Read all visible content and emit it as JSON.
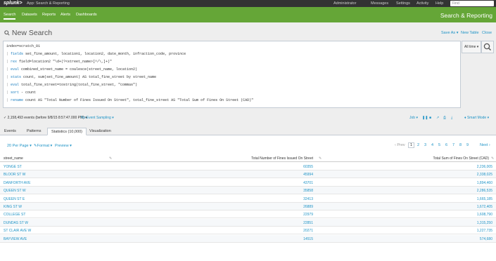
{
  "topbar": {
    "logo": "splunk>",
    "app_label": "App: Search & Reporting",
    "menu": [
      "Administrator",
      "Messages",
      "Settings",
      "Activity",
      "Help"
    ],
    "find_placeholder": "Find"
  },
  "appbar": {
    "nav": [
      "Search",
      "Datasets",
      "Reports",
      "Alerts",
      "Dashboards"
    ],
    "active": "Search",
    "app_title": "Search & Reporting"
  },
  "header": {
    "title": "New Search",
    "links": [
      "Save As",
      "New Table",
      "Close"
    ]
  },
  "search": {
    "lines": [
      {
        "pipe": "",
        "cmd": "index=scratch_01",
        "rest": ""
      },
      {
        "pipe": "| ",
        "cmd": "fields",
        "rest": " set_fine_amount, location1, location2, date_month, infraction_code, province"
      },
      {
        "pipe": "| ",
        "cmd": "rex",
        "rest": " field=location2 \"\\d+(?<street_name>[^/\\,]+)\""
      },
      {
        "pipe": "| ",
        "cmd": "eval",
        "rest": " combined_street_name = coalesce(street_name, location2)"
      },
      {
        "pipe": "| ",
        "cmd": "stats",
        "rest": " count, sum(set_fine_amount) AS total_fine_street by street_name"
      },
      {
        "pipe": "| ",
        "cmd": "eval",
        "rest": " total_fine_street=tostring(total_fine_street, \"commas\")"
      },
      {
        "pipe": "| ",
        "cmd": "sort",
        "rest": " - count"
      },
      {
        "pipe": "| ",
        "cmd": "rename",
        "rest": " count AS \"Total Number of Fines Issued On Street\", total_fine_street AS \"Total Sum of Fines On Street (CAD)\""
      }
    ],
    "time_range": "All time"
  },
  "status": {
    "events": "2,158,493 events (before 9/8/15 8:57:47.000 PM)",
    "sampling": "No Event Sampling",
    "job": "Job",
    "mode": "Smart Mode"
  },
  "tabs": [
    "Events",
    "Patterns",
    "Statistics (10,000)",
    "Visualization"
  ],
  "active_tab": "Statistics (10,000)",
  "toolbar": {
    "per_page": "20 Per Page",
    "format": "Format",
    "preview": "Preview"
  },
  "pagination": {
    "prev": "‹ Prev",
    "pages": [
      "1",
      "2",
      "3",
      "4",
      "5",
      "6",
      "7",
      "8",
      "9"
    ],
    "current": "1",
    "next": "Next ›"
  },
  "table": {
    "columns": [
      "street_name",
      "Total Number of Fines Issued On Street",
      "Total Sum of Fines On Street (CAD)"
    ],
    "rows": [
      [
        "YONGE ST",
        "60355",
        "2,236,005"
      ],
      [
        "BLOOR ST W",
        "45994",
        "2,338,025"
      ],
      [
        "DANFORTH AVE",
        "43701",
        "1,894,460"
      ],
      [
        "QUEEN ST W",
        "35858",
        "2,286,535"
      ],
      [
        "QUEEN ST E",
        "32413",
        "1,665,185"
      ],
      [
        "KING ST W",
        "26889",
        "1,672,405"
      ],
      [
        "COLLEGE ST",
        "22979",
        "1,608,790"
      ],
      [
        "DUNDAS ST W",
        "22851",
        "1,315,250"
      ],
      [
        "ST CLAIR AVE W",
        "20271",
        "1,227,735"
      ],
      [
        "BAYVIEW AVE",
        "14515",
        "574,680"
      ]
    ]
  },
  "colors": {
    "accent_green": "#65a637",
    "link_blue": "#1e93c6",
    "topbar": "#333333"
  }
}
